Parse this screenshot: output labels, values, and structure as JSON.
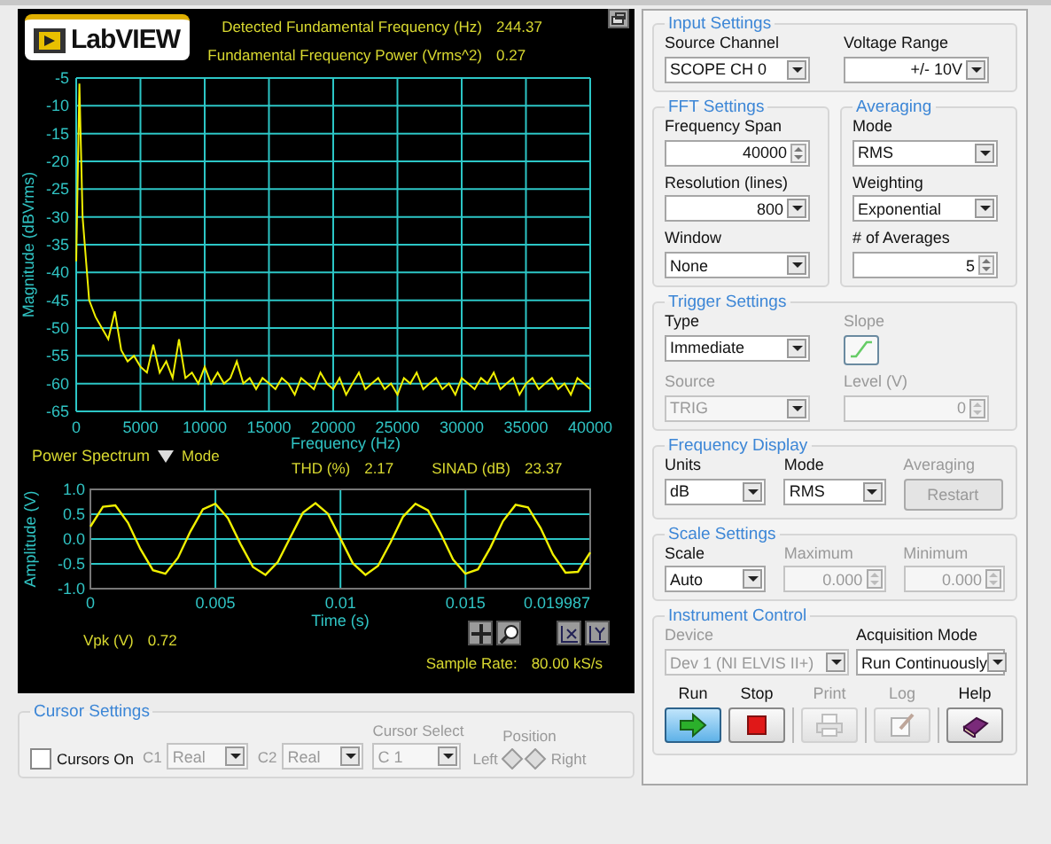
{
  "display": {
    "logo": "LabVIEW",
    "readouts": [
      {
        "label": "Detected Fundamental Frequency (Hz)",
        "value": "244.37"
      },
      {
        "label": "Fundamental Frequency Power (Vrms^2)",
        "value": "0.27"
      }
    ],
    "spectrum": {
      "chart_data": {
        "type": "line",
        "xlabel": "Frequency (Hz)",
        "ylabel": "Magnitude (dBVrms)",
        "xlim": [
          0,
          40000
        ],
        "ylim": [
          -65,
          -5
        ],
        "xticks": [
          0,
          5000,
          10000,
          15000,
          20000,
          25000,
          30000,
          35000,
          40000
        ],
        "yticks": [
          -5,
          -10,
          -15,
          -20,
          -25,
          -30,
          -35,
          -40,
          -45,
          -50,
          -55,
          -60,
          -65
        ],
        "x": [
          0,
          250,
          500,
          1000,
          1500,
          2000,
          2500,
          3000,
          3500,
          4000,
          4500,
          5000,
          5500,
          6000,
          6500,
          7000,
          7500,
          8000,
          8500,
          9000,
          9500,
          10000,
          10500,
          11000,
          11500,
          12000,
          12500,
          13000,
          13500,
          14000,
          14500,
          15000,
          15500,
          16000,
          16500,
          17000,
          17500,
          18000,
          18500,
          19000,
          19500,
          20000,
          20500,
          21000,
          21500,
          22000,
          22500,
          23000,
          23500,
          24000,
          24500,
          25000,
          25500,
          26000,
          26500,
          27000,
          27500,
          28000,
          28500,
          29000,
          29500,
          30000,
          30500,
          31000,
          31500,
          32000,
          32500,
          33000,
          33500,
          34000,
          34500,
          35000,
          35500,
          36000,
          36500,
          37000,
          37500,
          38000,
          38500,
          39000,
          39500,
          40000
        ],
        "grid": true,
        "series": [
          {
            "color": "#f0f000",
            "values": [
              -38,
              -6,
              -30,
              -45,
              -48,
              -50,
              -52,
              -47,
              -54,
              -56,
              -55,
              -57,
              -58,
              -53,
              -58,
              -56,
              -59,
              -52,
              -59,
              -58,
              -60,
              -57,
              -60,
              -58,
              -60,
              -59,
              -56,
              -60,
              -59,
              -61,
              -59,
              -60,
              -61,
              -59,
              -60,
              -62,
              -59,
              -60,
              -61,
              -58,
              -60,
              -61,
              -59,
              -62,
              -60,
              -58,
              -61,
              -60,
              -59,
              -61,
              -60,
              -62,
              -59,
              -60,
              -58,
              -61,
              -60,
              -59,
              -61,
              -60,
              -62,
              -59,
              -60,
              -61,
              -59,
              -60,
              -58,
              -61,
              -60,
              -59,
              -62,
              -60,
              -59,
              -61,
              -60,
              -59,
              -61,
              -60,
              -62,
              -59,
              -60,
              -61
            ]
          }
        ]
      }
    },
    "spectrum_mode": {
      "value": "Power Spectrum",
      "label": "Mode"
    },
    "distortion": [
      {
        "label": "THD (%)",
        "value": "2.17"
      },
      {
        "label": "SINAD (dB)",
        "value": "23.37"
      }
    ],
    "waveform": {
      "chart_data": {
        "type": "line",
        "xlabel": "Time (s)",
        "ylabel": "Amplitude (V)",
        "xlim": [
          0,
          0.019987
        ],
        "ylim": [
          -1,
          1
        ],
        "xticks": [
          0,
          0.005,
          0.01,
          0.015,
          0.019987
        ],
        "yticks": [
          {
            "value": 1,
            "label": "1.0"
          },
          {
            "value": 0.5,
            "label": "0.5"
          },
          {
            "value": 0,
            "label": "0.0"
          },
          {
            "value": -0.5,
            "label": "-0.5"
          },
          {
            "value": -1,
            "label": "-1.0"
          }
        ],
        "x": [
          0,
          0.0005,
          0.001,
          0.0015,
          0.002,
          0.0025,
          0.003,
          0.0035,
          0.004,
          0.0045,
          0.005,
          0.0055,
          0.006,
          0.0065,
          0.007,
          0.0075,
          0.008,
          0.0085,
          0.009,
          0.0095,
          0.01,
          0.0105,
          0.011,
          0.0115,
          0.012,
          0.0125,
          0.013,
          0.0135,
          0.014,
          0.0145,
          0.015,
          0.0155,
          0.016,
          0.0165,
          0.017,
          0.0175,
          0.018,
          0.0185,
          0.019,
          0.0195,
          0.019987
        ],
        "grid": true,
        "series": [
          {
            "color": "#f0f000",
            "values": [
              0.25,
              0.65,
              0.68,
              0.33,
              -0.2,
              -0.63,
              -0.7,
              -0.38,
              0.15,
              0.6,
              0.71,
              0.42,
              -0.1,
              -0.56,
              -0.72,
              -0.46,
              0.04,
              0.53,
              0.72,
              0.51,
              0.01,
              -0.49,
              -0.72,
              -0.54,
              -0.07,
              0.45,
              0.71,
              0.58,
              0.12,
              -0.41,
              -0.7,
              -0.61,
              -0.17,
              0.36,
              0.69,
              0.64,
              0.22,
              -0.31,
              -0.68,
              -0.66,
              -0.27
            ]
          }
        ]
      }
    },
    "vpk": {
      "label": "Vpk (V)",
      "value": "0.72"
    },
    "sample_rate": {
      "label": "Sample Rate:",
      "value": "80.00 kS/s"
    }
  },
  "cursor_settings": {
    "title": "Cursor Settings",
    "cursors_on": {
      "label": "Cursors On",
      "checked": false
    },
    "channels": [
      {
        "label": "C1",
        "value": "Real",
        "disabled": true
      },
      {
        "label": "C2",
        "value": "Real",
        "disabled": true
      }
    ],
    "cursor_select": {
      "label": "Cursor Select",
      "value": "C 1",
      "disabled": true
    },
    "position": {
      "label": "Position",
      "left": "Left",
      "right": "Right",
      "disabled": true
    }
  },
  "panel": {
    "rows": [
      {
        "groups": [
          {
            "title": "Input Settings",
            "controls": [
              {
                "kind": "dropdown",
                "label": "Source Channel",
                "value": "SCOPE CH 0",
                "disabled": false
              },
              {
                "kind": "ring",
                "label": "Voltage Range",
                "value": "+/- 10V",
                "disabled": false
              }
            ]
          }
        ]
      },
      {
        "groups": [
          {
            "title": "FFT Settings",
            "controls": [
              {
                "kind": "numeric",
                "label": "Frequency Span",
                "value": "40000",
                "disabled": false
              },
              {
                "kind": "ring",
                "label": "Resolution (lines)",
                "value": "800",
                "disabled": false
              },
              {
                "kind": "dropdown",
                "label": "Window",
                "value": "None",
                "disabled": false
              }
            ]
          },
          {
            "title": "Averaging",
            "controls": [
              {
                "kind": "dropdown",
                "label": "Mode",
                "value": "RMS",
                "disabled": false
              },
              {
                "kind": "dropdown",
                "label": "Weighting",
                "value": "Exponential",
                "disabled": false
              },
              {
                "kind": "numeric",
                "label": "# of Averages",
                "value": "5",
                "disabled": false
              }
            ]
          }
        ]
      },
      {
        "groups": [
          {
            "title": "Trigger Settings",
            "controls": [
              {
                "kind": "dropdown",
                "label": "Type",
                "value": "Immediate",
                "disabled": false
              },
              {
                "kind": "slope",
                "label": "Slope",
                "disabled": true
              },
              {
                "kind": "dropdown",
                "label": "Source",
                "value": "TRIG",
                "disabled": true
              },
              {
                "kind": "numeric",
                "label": "Level (V)",
                "value": "0",
                "disabled": true
              }
            ]
          }
        ]
      },
      {
        "groups": [
          {
            "title": "Frequency Display",
            "controls": [
              {
                "kind": "dropdown",
                "label": "Units",
                "value": "dB",
                "disabled": false
              },
              {
                "kind": "dropdown",
                "label": "Mode",
                "value": "RMS",
                "disabled": false
              },
              {
                "kind": "button",
                "label": "Averaging",
                "text": "Restart",
                "disabled": true
              }
            ]
          }
        ]
      },
      {
        "groups": [
          {
            "title": "Scale Settings",
            "controls": [
              {
                "kind": "dropdown",
                "label": "Scale",
                "value": "Auto",
                "disabled": false
              },
              {
                "kind": "numeric",
                "label": "Maximum",
                "value": "0.000",
                "disabled": true
              },
              {
                "kind": "numeric",
                "label": "Minimum",
                "value": "0.000",
                "disabled": true
              }
            ]
          }
        ]
      }
    ]
  },
  "instrument_control": {
    "title": "Instrument Control",
    "controls": [
      {
        "label": "Device",
        "value": "Dev 1 (NI ELVIS II+)",
        "disabled": true
      },
      {
        "label": "Acquisition Mode",
        "value": "Run Continuously",
        "disabled": false
      }
    ],
    "buttons": [
      {
        "kind": "run",
        "label": "Run",
        "active": true,
        "disabled": false
      },
      {
        "kind": "stop",
        "label": "Stop",
        "active": false,
        "disabled": false
      },
      {
        "kind": "print",
        "label": "Print",
        "active": false,
        "disabled": true
      },
      {
        "kind": "log",
        "label": "Log",
        "active": false,
        "disabled": true
      },
      {
        "kind": "help",
        "label": "Help",
        "active": false,
        "disabled": false
      }
    ]
  }
}
